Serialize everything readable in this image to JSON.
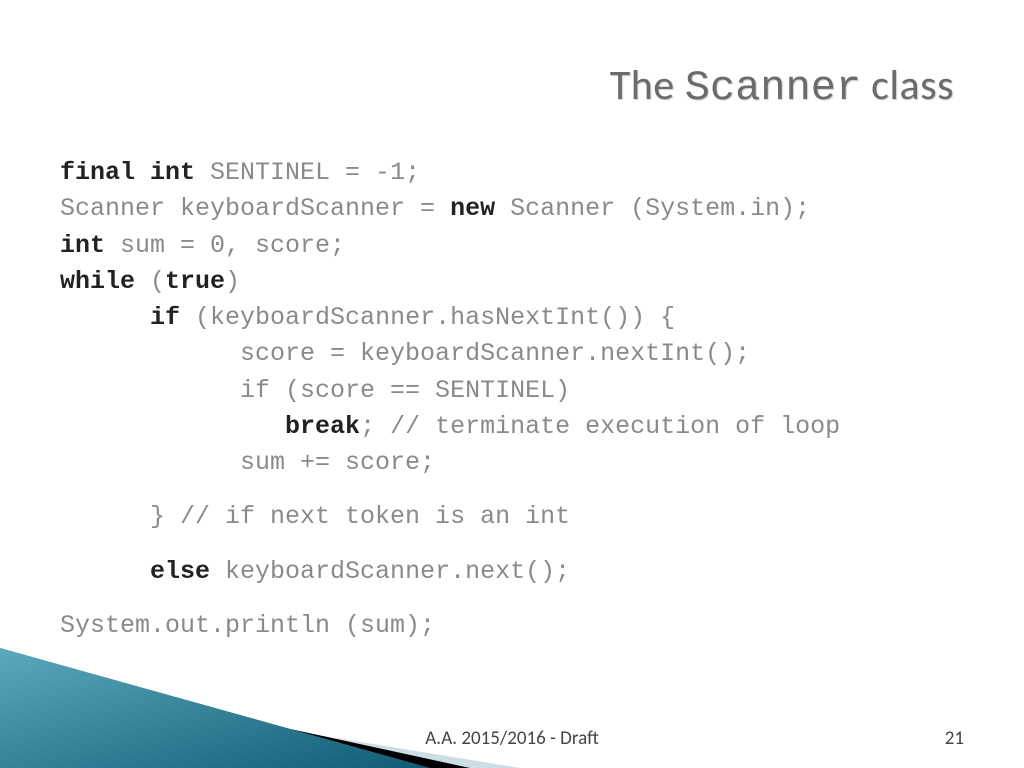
{
  "title": {
    "pre": "The ",
    "mono": "Scanner",
    "post": " class"
  },
  "code": {
    "l1a": "final int",
    "l1b": " SENTINEL = -1;",
    "l2a": "Scanner keyboardScanner = ",
    "l2b": "new",
    "l2c": " Scanner (System.in);",
    "l3a": "int",
    "l3b": " sum = 0, score;",
    "l4a": "while",
    "l4b": " (",
    "l4c": "true",
    "l4d": ")",
    "l5a": "      ",
    "l5b": "if",
    "l5c": " (keyboardScanner.hasNextInt()) {",
    "l6": "            score = keyboardScanner.nextInt();",
    "l7": "            if (score == SENTINEL)",
    "l8a": "               ",
    "l8b": "break",
    "l8c": "; // terminate execution of loop",
    "l9": "            sum += score;",
    "l10": "      } // if next token is an int",
    "l11a": "      ",
    "l11b": "else",
    "l11c": " keyboardScanner.next();",
    "l12": "System.out.println (sum);"
  },
  "footer": "A.A. 2015/2016  -  Draft",
  "page": "21"
}
